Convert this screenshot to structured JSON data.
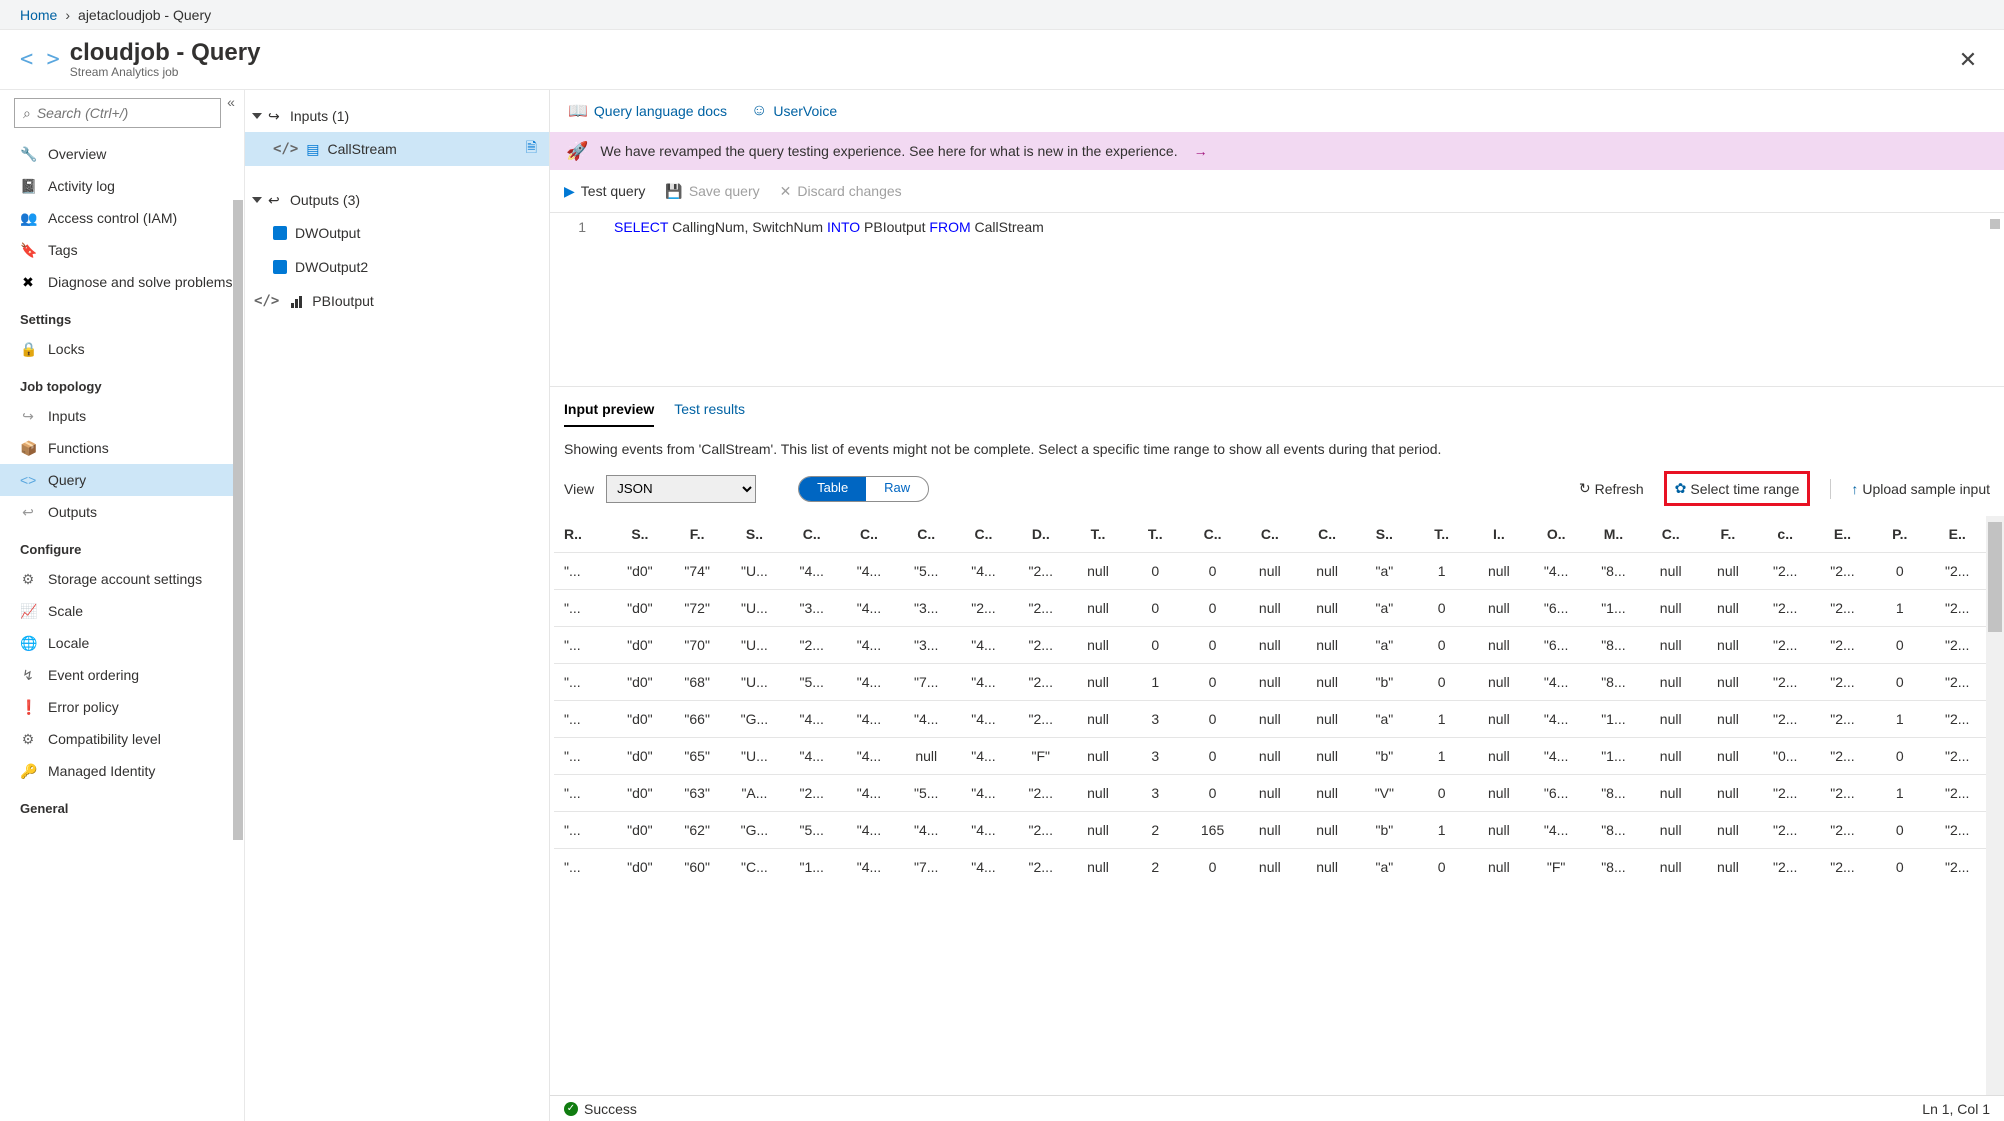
{
  "breadcrumb": {
    "home": "Home",
    "current": "ajetacloudjob - Query"
  },
  "header": {
    "title": "cloudjob - Query",
    "subtitle": "Stream Analytics job"
  },
  "search": {
    "placeholder": "Search (Ctrl+/)"
  },
  "sidebar": {
    "items": [
      {
        "icon": "🔧",
        "iconColor": "#6BA644",
        "label": "Overview"
      },
      {
        "icon": "📓",
        "iconColor": "#0b60b8",
        "label": "Activity log"
      },
      {
        "icon": "👥",
        "iconColor": "#0b60b8",
        "label": "Access control (IAM)"
      },
      {
        "icon": "🔖",
        "iconColor": "#6c3eb5",
        "label": "Tags"
      },
      {
        "icon": "✖",
        "iconColor": "#000",
        "label": "Diagnose and solve problems"
      }
    ],
    "sections": [
      {
        "header": "Settings",
        "items": [
          {
            "icon": "🔒",
            "iconColor": "#000",
            "label": "Locks"
          }
        ]
      },
      {
        "header": "Job topology",
        "items": [
          {
            "icon": "↪",
            "iconColor": "#999",
            "label": "Inputs"
          },
          {
            "icon": "📦",
            "iconColor": "#0b60b8",
            "label": "Functions"
          },
          {
            "icon": "<>",
            "iconColor": "#59a6de",
            "label": "Query",
            "selected": true
          },
          {
            "icon": "↩",
            "iconColor": "#999",
            "label": "Outputs"
          }
        ]
      },
      {
        "header": "Configure",
        "items": [
          {
            "icon": "⚙",
            "iconColor": "#666",
            "label": "Storage account settings"
          },
          {
            "icon": "📈",
            "iconColor": "#666",
            "label": "Scale"
          },
          {
            "icon": "🌐",
            "iconColor": "#2aa82a",
            "label": "Locale"
          },
          {
            "icon": "↯",
            "iconColor": "#666",
            "label": "Event ordering"
          },
          {
            "icon": "❗",
            "iconColor": "#d83b01",
            "label": "Error policy"
          },
          {
            "icon": "⚙",
            "iconColor": "#666",
            "label": "Compatibility level"
          },
          {
            "icon": "🔑",
            "iconColor": "#e8b800",
            "label": "Managed Identity"
          }
        ]
      },
      {
        "header": "General",
        "items": []
      }
    ]
  },
  "tree": {
    "inputs_label": "Inputs (1)",
    "inputs": [
      {
        "name": "CallStream",
        "selected": true
      }
    ],
    "outputs_label": "Outputs (3)",
    "outputs": [
      {
        "name": "DWOutput",
        "type": "db"
      },
      {
        "name": "DWOutput2",
        "type": "db"
      },
      {
        "name": "PBIoutput",
        "type": "pbi"
      }
    ]
  },
  "topbar": {
    "docs": "Query language docs",
    "uservoice": "UserVoice"
  },
  "banner": {
    "text": "We have revamped the query testing experience. See here for what is new in the experience."
  },
  "query_toolbar": {
    "test": "Test query",
    "save": "Save query",
    "discard": "Discard changes"
  },
  "code": {
    "line_no": "1",
    "select": "SELECT",
    "cols": " CallingNum, SwitchNum ",
    "into": "INTO",
    "target": " PBIoutput ",
    "from": "FROM",
    "source": " CallStream"
  },
  "tabs": {
    "preview": "Input preview",
    "results": "Test results"
  },
  "preview_text": "Showing events from 'CallStream'. This list of events might not be complete. Select a specific time range to show all events during that period.",
  "controls": {
    "view_label": "View",
    "view_value": "JSON",
    "table": "Table",
    "raw": "Raw",
    "refresh": "Refresh",
    "timerange": "Select time range",
    "upload": "Upload sample input"
  },
  "table": {
    "headers": [
      "R..",
      "S..",
      "F..",
      "S..",
      "C..",
      "C..",
      "C..",
      "C..",
      "D..",
      "T..",
      "T..",
      "C..",
      "C..",
      "C..",
      "S..",
      "T..",
      "I..",
      "O..",
      "M..",
      "C..",
      "F..",
      "c..",
      "E..",
      "P..",
      "E.."
    ],
    "rows": [
      [
        "\"...",
        "\"d0\"",
        "\"74\"",
        "\"U...",
        "\"4...",
        "\"4...",
        "\"5...",
        "\"4...",
        "\"2...",
        "null",
        "0",
        "0",
        "null",
        "null",
        "\"a\"",
        "1",
        "null",
        "\"4...",
        "\"8...",
        "null",
        "null",
        "\"2...",
        "\"2...",
        "0",
        "\"2..."
      ],
      [
        "\"...",
        "\"d0\"",
        "\"72\"",
        "\"U...",
        "\"3...",
        "\"4...",
        "\"3...",
        "\"2...",
        "\"2...",
        "null",
        "0",
        "0",
        "null",
        "null",
        "\"a\"",
        "0",
        "null",
        "\"6...",
        "\"1...",
        "null",
        "null",
        "\"2...",
        "\"2...",
        "1",
        "\"2..."
      ],
      [
        "\"...",
        "\"d0\"",
        "\"70\"",
        "\"U...",
        "\"2...",
        "\"4...",
        "\"3...",
        "\"4...",
        "\"2...",
        "null",
        "0",
        "0",
        "null",
        "null",
        "\"a\"",
        "0",
        "null",
        "\"6...",
        "\"8...",
        "null",
        "null",
        "\"2...",
        "\"2...",
        "0",
        "\"2..."
      ],
      [
        "\"...",
        "\"d0\"",
        "\"68\"",
        "\"U...",
        "\"5...",
        "\"4...",
        "\"7...",
        "\"4...",
        "\"2...",
        "null",
        "1",
        "0",
        "null",
        "null",
        "\"b\"",
        "0",
        "null",
        "\"4...",
        "\"8...",
        "null",
        "null",
        "\"2...",
        "\"2...",
        "0",
        "\"2..."
      ],
      [
        "\"...",
        "\"d0\"",
        "\"66\"",
        "\"G...",
        "\"4...",
        "\"4...",
        "\"4...",
        "\"4...",
        "\"2...",
        "null",
        "3",
        "0",
        "null",
        "null",
        "\"a\"",
        "1",
        "null",
        "\"4...",
        "\"1...",
        "null",
        "null",
        "\"2...",
        "\"2...",
        "1",
        "\"2..."
      ],
      [
        "\"...",
        "\"d0\"",
        "\"65\"",
        "\"U...",
        "\"4...",
        "\"4...",
        "null",
        "\"4...",
        "\"F\"",
        "null",
        "3",
        "0",
        "null",
        "null",
        "\"b\"",
        "1",
        "null",
        "\"4...",
        "\"1...",
        "null",
        "null",
        "\"0...",
        "\"2...",
        "0",
        "\"2..."
      ],
      [
        "\"...",
        "\"d0\"",
        "\"63\"",
        "\"A...",
        "\"2...",
        "\"4...",
        "\"5...",
        "\"4...",
        "\"2...",
        "null",
        "3",
        "0",
        "null",
        "null",
        "\"V\"",
        "0",
        "null",
        "\"6...",
        "\"8...",
        "null",
        "null",
        "\"2...",
        "\"2...",
        "1",
        "\"2..."
      ],
      [
        "\"...",
        "\"d0\"",
        "\"62\"",
        "\"G...",
        "\"5...",
        "\"4...",
        "\"4...",
        "\"4...",
        "\"2...",
        "null",
        "2",
        "165",
        "null",
        "null",
        "\"b\"",
        "1",
        "null",
        "\"4...",
        "\"8...",
        "null",
        "null",
        "\"2...",
        "\"2...",
        "0",
        "\"2..."
      ],
      [
        "\"...",
        "\"d0\"",
        "\"60\"",
        "\"C...",
        "\"1...",
        "\"4...",
        "\"7...",
        "\"4...",
        "\"2...",
        "null",
        "2",
        "0",
        "null",
        "null",
        "\"a\"",
        "0",
        "null",
        "\"F\"",
        "\"8...",
        "null",
        "null",
        "\"2...",
        "\"2...",
        "0",
        "\"2..."
      ]
    ]
  },
  "status": {
    "ok": "Success",
    "position": "Ln 1, Col 1"
  }
}
